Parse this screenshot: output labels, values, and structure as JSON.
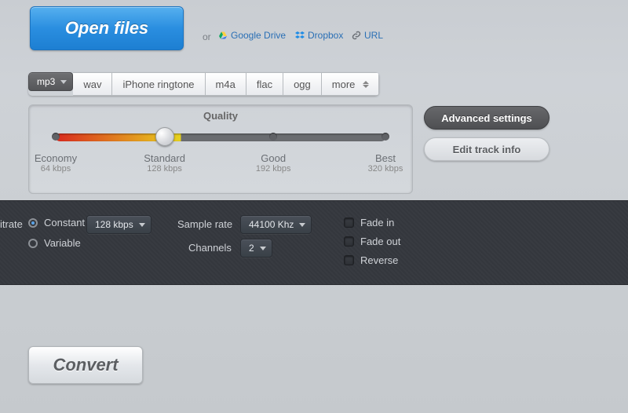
{
  "open_files_label": "Open files",
  "or_label": "or",
  "sources": {
    "gdrive": "Google Drive",
    "dropbox": "Dropbox",
    "url": "URL"
  },
  "formats": [
    "mp3",
    "wav",
    "iPhone ringtone",
    "m4a",
    "flac",
    "ogg",
    "more"
  ],
  "selected_format_index": 0,
  "quality": {
    "title": "Quality",
    "handle_pct": 33,
    "stops": [
      {
        "pct": 0,
        "label": "Economy",
        "sub": "64 kbps"
      },
      {
        "pct": 33,
        "label": "Standard",
        "sub": "128 kbps"
      },
      {
        "pct": 66,
        "label": "Good",
        "sub": "192 kbps"
      },
      {
        "pct": 100,
        "label": "Best",
        "sub": "320 kbps"
      }
    ]
  },
  "side": {
    "advanced": "Advanced settings",
    "edit": "Edit track info"
  },
  "advanced": {
    "bitrate_label": "itrate",
    "constant_label": "Constant",
    "variable_label": "Variable",
    "bitrate_mode": "constant",
    "bitrate_value": "128 kbps",
    "samplerate_label": "Sample rate",
    "samplerate_value": "44100 Khz",
    "channels_label": "Channels",
    "channels_value": "2",
    "fadein_label": "Fade in",
    "fadeout_label": "Fade out",
    "reverse_label": "Reverse",
    "fadein": false,
    "fadeout": false,
    "reverse": false
  },
  "convert_label": "Convert"
}
